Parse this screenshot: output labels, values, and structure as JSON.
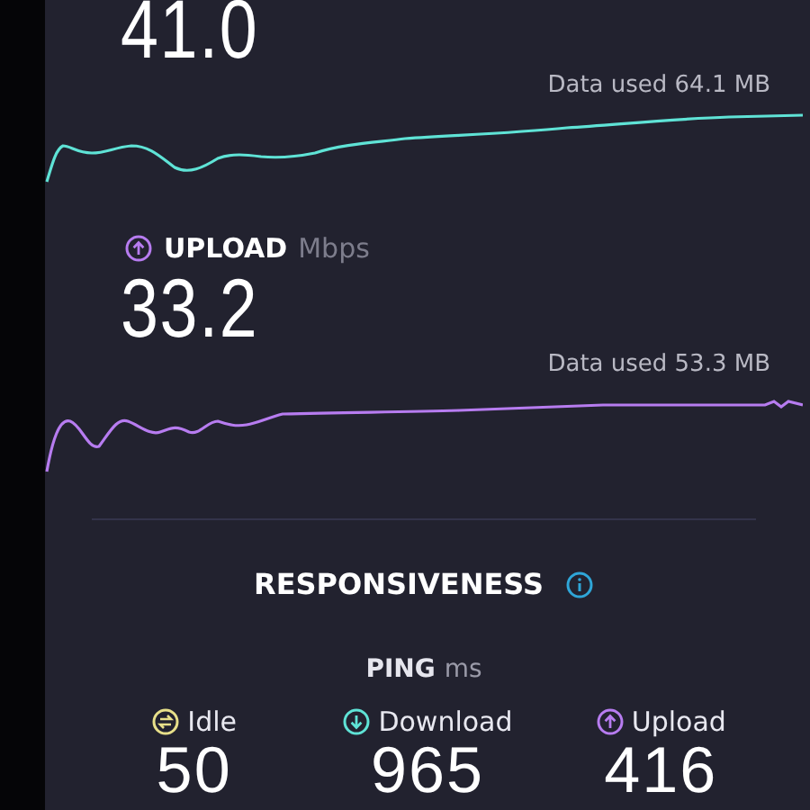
{
  "download": {
    "value": "41.0",
    "data_used": "Data used 64.1 MB"
  },
  "upload": {
    "label": "UPLOAD",
    "unit": "Mbps",
    "value": "33.2",
    "data_used": "Data used 53.3 MB"
  },
  "responsiveness": {
    "title": "RESPONSIVENESS",
    "ping_label": "PING",
    "ping_unit": "ms",
    "items": [
      {
        "kind": "idle",
        "label": "Idle",
        "value": "50",
        "color": "#e8e08a"
      },
      {
        "kind": "download",
        "label": "Download",
        "value": "965",
        "color": "#5fe3d6"
      },
      {
        "kind": "upload",
        "label": "Upload",
        "value": "416",
        "color": "#b77cf0"
      }
    ]
  }
}
